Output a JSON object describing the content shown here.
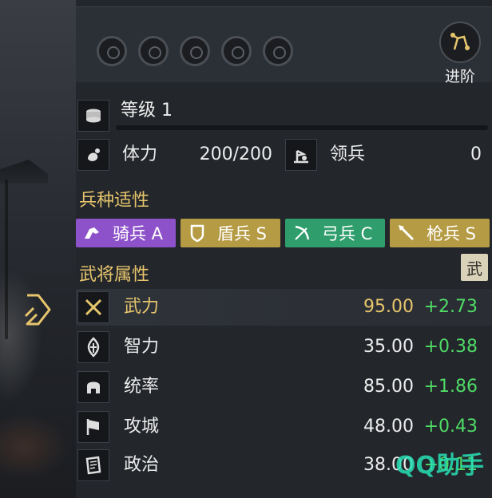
{
  "header": {
    "advance_label": "进阶"
  },
  "level": {
    "label": "等级 1"
  },
  "stamina": {
    "label": "体力",
    "value": "200/200"
  },
  "troops": {
    "label": "领兵",
    "value": "0"
  },
  "adaptability": {
    "title": "兵种适性",
    "chips": [
      {
        "label": "骑兵 A",
        "color": "#8d52c9"
      },
      {
        "label": "盾兵 S",
        "color": "#b59b43"
      },
      {
        "label": "弓兵 C",
        "color": "#2f9e6c"
      },
      {
        "label": "枪兵 S",
        "color": "#b59b43"
      }
    ]
  },
  "attributes": {
    "title": "武将属性",
    "tag": "武",
    "rows": [
      {
        "name": "武力",
        "value": "95.00",
        "bonus": "+2.73",
        "icon": "crossed-swords-icon",
        "highlight": true
      },
      {
        "name": "智力",
        "value": "35.00",
        "bonus": "+0.38",
        "icon": "flame-icon",
        "highlight": false
      },
      {
        "name": "统率",
        "value": "85.00",
        "bonus": "+1.86",
        "icon": "helmet-icon",
        "highlight": false
      },
      {
        "name": "攻城",
        "value": "48.00",
        "bonus": "+0.43",
        "icon": "flag-icon",
        "highlight": false
      },
      {
        "name": "政治",
        "value": "38.00",
        "bonus": "+0.11",
        "icon": "scroll-icon",
        "highlight": false
      }
    ]
  },
  "watermark": "QQ助手",
  "colors": {
    "gold": "#e6c56c",
    "green": "#4fdb66",
    "panel": "#23262b"
  }
}
